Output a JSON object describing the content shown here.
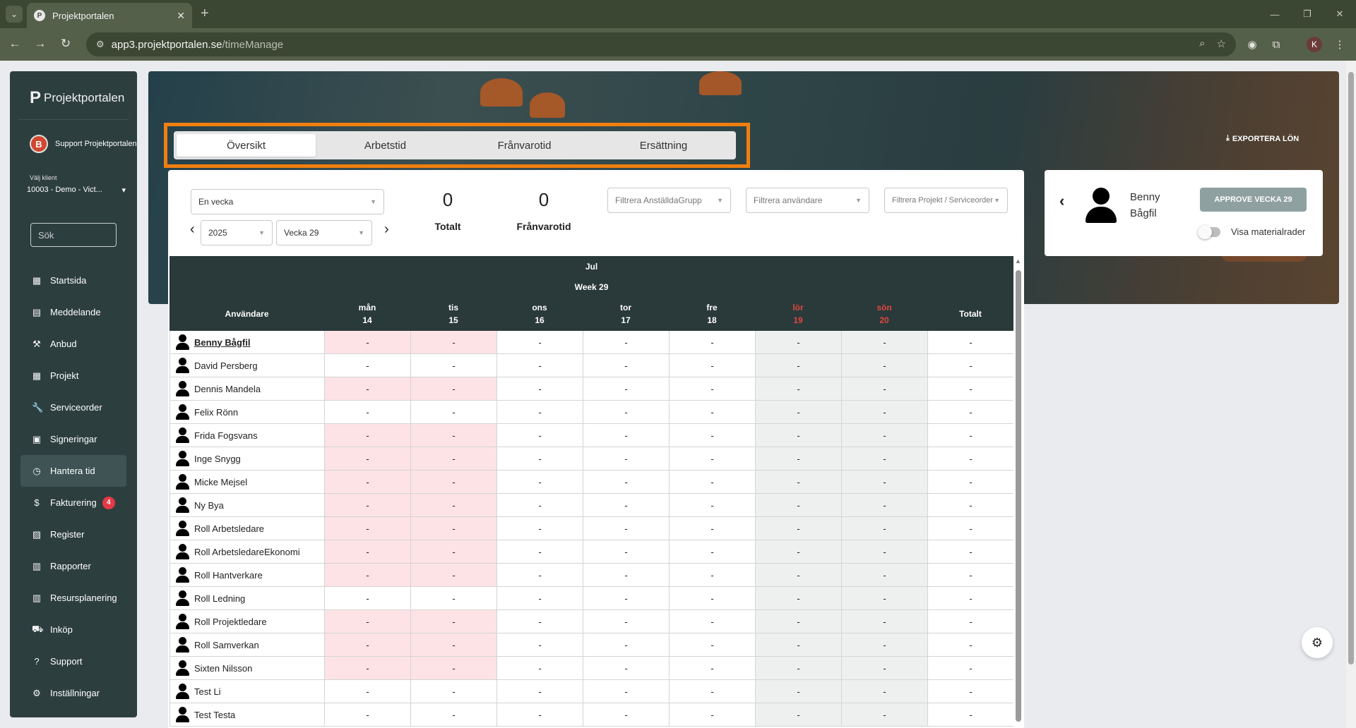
{
  "browser": {
    "tab_title": "Projektportalen",
    "favicon": "P",
    "url_domain": "app3.projektportalen.se",
    "url_path": "/timeManage",
    "profile_initial": "K"
  },
  "sidebar": {
    "brand": "Projektportalen",
    "brand_mark": "P",
    "user_initial": "B",
    "user_name": "Support Projektportalen",
    "client_label": "Välj klient",
    "client_value": "10003 - Demo - Vict...",
    "search_placeholder": "Sök",
    "items": [
      {
        "label": "Startsida",
        "icon": "grid-icon"
      },
      {
        "label": "Meddelande",
        "icon": "message-icon"
      },
      {
        "label": "Anbud",
        "icon": "gavel-icon"
      },
      {
        "label": "Projekt",
        "icon": "grid-icon"
      },
      {
        "label": "Serviceorder",
        "icon": "wrench-icon"
      },
      {
        "label": "Signeringar",
        "icon": "document-icon"
      },
      {
        "label": "Hantera tid",
        "icon": "clock-icon",
        "active": true
      },
      {
        "label": "Fakturering",
        "icon": "dollar-icon",
        "badge": "4"
      },
      {
        "label": "Register",
        "icon": "image-icon"
      },
      {
        "label": "Rapporter",
        "icon": "calendar-icon"
      },
      {
        "label": "Resursplanering",
        "icon": "calendar-icon"
      },
      {
        "label": "Inköp",
        "icon": "cart-icon"
      },
      {
        "label": "Support",
        "icon": "help-icon"
      },
      {
        "label": "Inställningar",
        "icon": "gear-icon"
      }
    ]
  },
  "header": {
    "export_label": "EXPORTERA LÖN",
    "tabs": [
      "Översikt",
      "Arbetstid",
      "Frånvarotid",
      "Ersättning"
    ],
    "active_tab": 0
  },
  "filters": {
    "period": "En vecka",
    "year": "2025",
    "week": "Vecka 29",
    "group_placeholder": "Filtrera AnställdaGrupp",
    "user_placeholder": "Filtrera användare",
    "project_placeholder": "Filtrera Projekt / Serviceorder"
  },
  "stats": {
    "total_value": "0",
    "total_label": "Totalt",
    "absence_value": "0",
    "absence_label": "Frånvarotid"
  },
  "table": {
    "month": "Jul",
    "week": "Week 29",
    "user_header": "Användare",
    "total_header": "Totalt",
    "days": [
      {
        "name": "mån",
        "date": "14",
        "weekend": false
      },
      {
        "name": "tis",
        "date": "15",
        "weekend": false
      },
      {
        "name": "ons",
        "date": "16",
        "weekend": false
      },
      {
        "name": "tor",
        "date": "17",
        "weekend": false
      },
      {
        "name": "fre",
        "date": "18",
        "weekend": false
      },
      {
        "name": "lör",
        "date": "19",
        "weekend": true
      },
      {
        "name": "sön",
        "date": "20",
        "weekend": true
      }
    ],
    "empty_cell": "-",
    "rows": [
      {
        "name": "Benny Bågfil",
        "selected": true,
        "pink": [
          0,
          1
        ]
      },
      {
        "name": "David Persberg",
        "pink": []
      },
      {
        "name": "Dennis Mandela",
        "pink": [
          0,
          1
        ]
      },
      {
        "name": "Felix Rönn",
        "pink": []
      },
      {
        "name": "Frida Fogsvans",
        "pink": [
          0,
          1
        ]
      },
      {
        "name": "Inge Snygg",
        "pink": [
          0,
          1
        ]
      },
      {
        "name": "Micke Mejsel",
        "pink": [
          0,
          1
        ]
      },
      {
        "name": "Ny Bya",
        "pink": [
          0,
          1
        ]
      },
      {
        "name": "Roll Arbetsledare",
        "pink": [
          0,
          1
        ]
      },
      {
        "name": "Roll ArbetsledareEkonomi",
        "pink": [
          0,
          1
        ]
      },
      {
        "name": "Roll Hantverkare",
        "pink": [
          0,
          1
        ]
      },
      {
        "name": "Roll Ledning",
        "pink": []
      },
      {
        "name": "Roll Projektledare",
        "pink": [
          0,
          1
        ]
      },
      {
        "name": "Roll Samverkan",
        "pink": [
          0,
          1
        ]
      },
      {
        "name": "Sixten Nilsson",
        "pink": [
          0,
          1
        ]
      },
      {
        "name": "Test Li",
        "pink": []
      },
      {
        "name": "Test Testa",
        "pink": []
      }
    ]
  },
  "panel": {
    "user_name": "Benny Bågfil",
    "approve_label": "APPROVE VECKA 29",
    "toggle_label": "Visa materialrader",
    "toggle_on": false
  },
  "colors": {
    "sidebar_bg": "#2d3e3f",
    "table_header_bg": "#2a393a",
    "highlight": "#f07f0f",
    "pink_cell": "#fde3e6",
    "weekend_cell": "#eef0f0",
    "weekend_header": "#e0493f",
    "badge": "#e53946"
  }
}
